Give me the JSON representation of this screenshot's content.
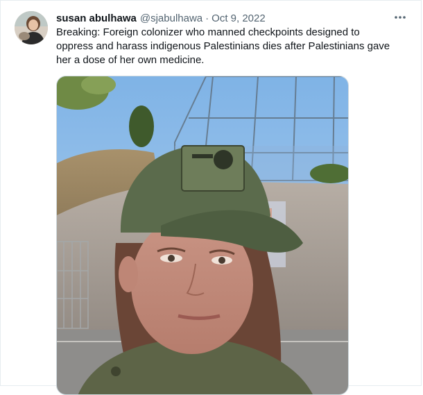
{
  "tweet": {
    "author": {
      "display_name": "susan abulhawa",
      "handle": "@sjabulhawa",
      "avatar_icon": "user-avatar-photo"
    },
    "separator": "·",
    "date": "Oct 9, 2022",
    "more_icon": "more-horizontal-icon",
    "text_lines": [
      "Breaking: Foreign colonizer who manned checkpoints designed to",
      "oppress and harass indigenous Palestinians dies after Palestinians gave",
      "her a dose of her own medicine."
    ],
    "media": {
      "type": "photo"
    }
  },
  "colors": {
    "text_primary": "#0f1419",
    "text_secondary": "#536471",
    "border": "#e6ecf0"
  }
}
